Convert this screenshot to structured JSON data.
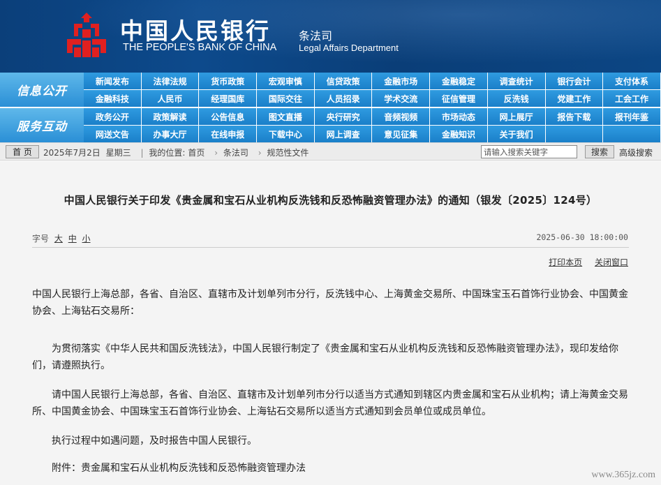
{
  "header": {
    "bank_name_cn": "中国人民银行",
    "bank_name_en": "THE PEOPLE'S BANK OF CHINA",
    "dept_cn": "条法司",
    "dept_en": "Legal Affairs Department",
    "brand_color": "#0b3f7a",
    "logo_color": "#e02020"
  },
  "nav": {
    "groups": [
      {
        "label": "信息公开",
        "rows": [
          [
            "新闻发布",
            "法律法规",
            "货币政策",
            "宏观审慎",
            "信贷政策",
            "金融市场",
            "金融稳定",
            "调查统计",
            "银行会计",
            "支付体系"
          ],
          [
            "金融科技",
            "人民币",
            "经理国库",
            "国际交往",
            "人员招录",
            "学术交流",
            "征信管理",
            "反洗钱",
            "党建工作",
            "工会工作"
          ]
        ]
      },
      {
        "label": "服务互动",
        "rows": [
          [
            "政务公开",
            "政策解读",
            "公告信息",
            "图文直播",
            "央行研究",
            "音频视频",
            "市场动态",
            "网上展厅",
            "报告下载",
            "报刊年鉴"
          ],
          [
            "网送文告",
            "办事大厅",
            "在线申报",
            "下载中心",
            "网上调查",
            "意见征集",
            "金融知识",
            "关于我们",
            "",
            ""
          ]
        ]
      }
    ],
    "accent_color": "#1f86cf"
  },
  "infobar": {
    "home_label": "首 页",
    "date": "2025年7月2日",
    "weekday": "星期三",
    "location_prefix": "我的位置:",
    "crumb_home": "首页",
    "crumb_dept": "条法司",
    "crumb_current": "规范性文件",
    "crumb_separator": "›",
    "search_placeholder": "请输入搜索关键字",
    "search_button": "搜索",
    "advanced_search": "高级搜索"
  },
  "article": {
    "title": "中国人民银行关于印发《贵金属和宝石从业机构反洗钱和反恐怖融资管理办法》的通知（银发〔2025〕124号）",
    "font_size_label": "字号",
    "font_large": "大",
    "font_medium": "中",
    "font_small": "小",
    "publish_datetime": "2025-06-30 18:00:00",
    "print_label": "打印本页",
    "close_label": "关闭窗口",
    "addressees": "中国人民银行上海总部，各省、自治区、直辖市及计划单列市分行，反洗钱中心、上海黄金交易所、中国珠宝玉石首饰行业协会、中国黄金协会、上海钻石交易所：",
    "paragraph_1": "为贯彻落实《中华人民共和国反洗钱法》，中国人民银行制定了《贵金属和宝石从业机构反洗钱和反恐怖融资管理办法》，现印发给你们，请遵照执行。",
    "paragraph_2": "请中国人民银行上海总部，各省、自治区、直辖市及计划单列市分行以适当方式通知到辖区内贵金属和宝石从业机构；请上海黄金交易所、中国黄金协会、中国珠宝玉石首饰行业协会、上海钻石交易所以适当方式通知到会员单位或成员单位。",
    "paragraph_3": "执行过程中如遇问题，及时报告中国人民银行。",
    "attachment": "附件：贵金属和宝石从业机构反洗钱和反恐怖融资管理办法"
  },
  "watermark": "www.365jz.com"
}
